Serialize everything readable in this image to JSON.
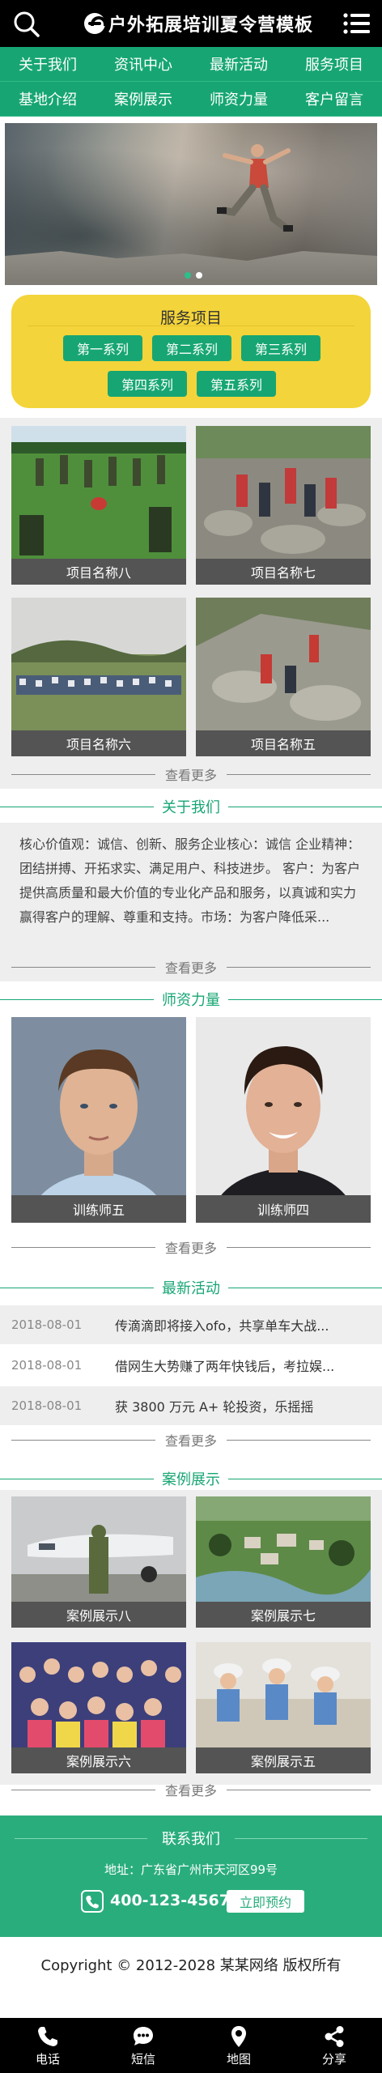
{
  "header": {
    "logo_text": "户外拓展培训夏令营模板",
    "search_icon": "search-icon",
    "menu_icon": "hamburger-menu-icon"
  },
  "nav": {
    "items": [
      "关于我们",
      "资讯中心",
      "最新活动",
      "服务项目",
      "基地介绍",
      "案例展示",
      "师资力量",
      "客户留言"
    ]
  },
  "banner": {
    "slide_count": 2,
    "active_slide": 1
  },
  "services": {
    "title": "服务项目",
    "buttons": [
      "第一系列",
      "第二系列",
      "第三系列",
      "第四系列",
      "第五系列"
    ]
  },
  "projects": {
    "items": [
      "项目名称八",
      "项目名称七",
      "项目名称六",
      "项目名称五"
    ],
    "more": "查看更多"
  },
  "about": {
    "title": "关于我们",
    "text": "核心价值观：诚信、创新、服务企业核心：诚信 企业精神：团结拼搏、开拓求实、满足用户、科技进步。 客户：为客户提供高质量和最大价值的专业化产品和服务，以真诚和实力赢得客户的理解、尊重和支持。市场：为客户降低采...",
    "more": "查看更多"
  },
  "teachers": {
    "title": "师资力量",
    "items": [
      "训练师五",
      "训练师四"
    ],
    "more": "查看更多"
  },
  "news": {
    "title": "最新活动",
    "items": [
      {
        "date": "2018-08-01",
        "title": "传滴滴即将接入ofo，共享单车大战..."
      },
      {
        "date": "2018-08-01",
        "title": "借网生大势赚了两年快钱后，考拉娱..."
      },
      {
        "date": "2018-08-01",
        "title": "获 3800 万元 A+ 轮投资，乐摇摇"
      }
    ],
    "more": "查看更多"
  },
  "cases": {
    "title": "案例展示",
    "items": [
      "案例展示八",
      "案例展示七",
      "案例展示六",
      "案例展示五"
    ],
    "more": "查看更多"
  },
  "contact": {
    "title": "联系我们",
    "address": "地址：广东省广州市天河区99号",
    "phone": "400-123-4567",
    "book_button": "立即预约"
  },
  "footer": {
    "copyright": "Copyright © 2012-2028 某某网络 版权所有"
  },
  "bottombar": {
    "tabs": [
      {
        "label": "电话",
        "icon": "phone-icon"
      },
      {
        "label": "短信",
        "icon": "message-icon"
      },
      {
        "label": "地图",
        "icon": "map-pin-icon"
      },
      {
        "label": "分享",
        "icon": "share-icon"
      }
    ]
  },
  "colors": {
    "brand_green": "#17a673",
    "contact_green": "#2aad7d",
    "service_yellow": "#f3d43a",
    "header_black": "#000000"
  }
}
